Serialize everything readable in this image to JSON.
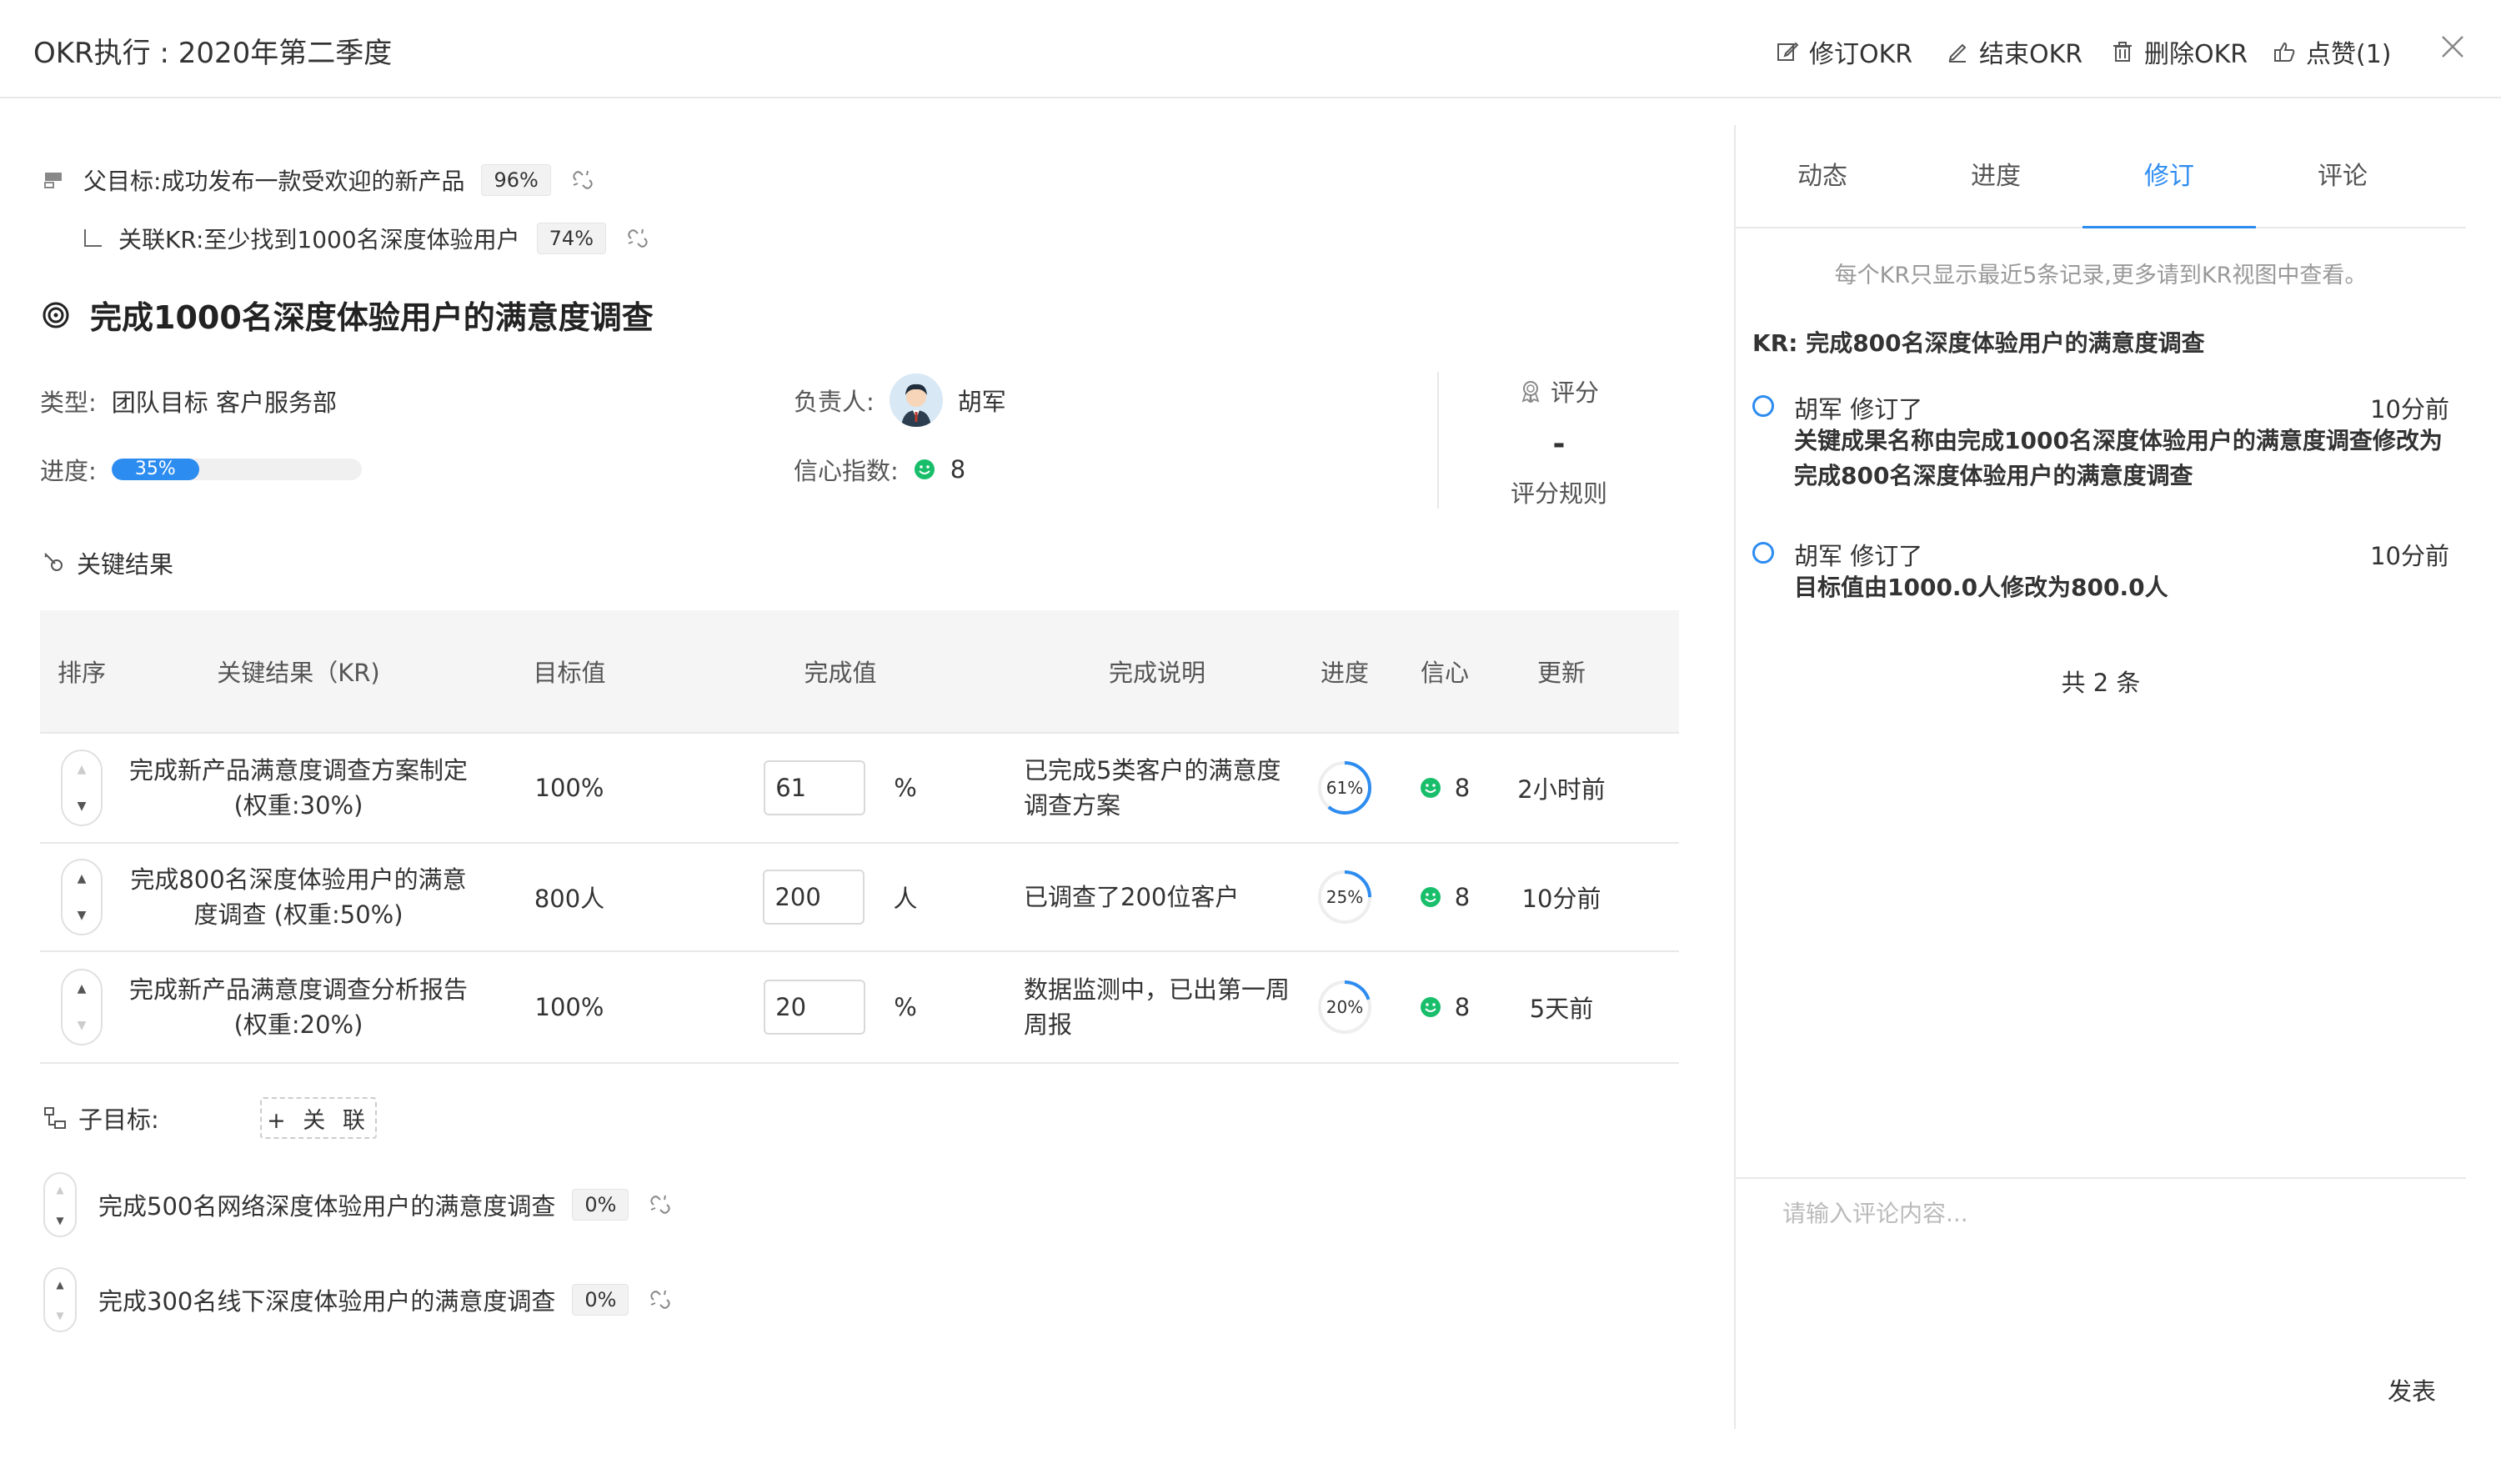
{
  "header": {
    "title": "OKR执行 : 2020年第二季度",
    "revise_okr": "修订OKR",
    "end_okr": "结束OKR",
    "delete_okr": "删除OKR",
    "like": "点赞(1)"
  },
  "parent": {
    "label": "父目标: ",
    "name": "成功发布一款受欢迎的新产品",
    "progress": "96%"
  },
  "linked_kr": {
    "label": "关联KR: ",
    "name": "至少找到1000名深度体验用户",
    "progress": "74%"
  },
  "objective": {
    "title": "完成1000名深度体验用户的满意度调查",
    "type_label": "类型:",
    "type_value": "团队目标 客户服务部",
    "owner_label": "负责人:",
    "owner_name": "胡军",
    "progress_label": "进度:",
    "progress_value": "35%",
    "progress_fraction": 0.35,
    "confidence_label": "信心指数:",
    "confidence_value": "8",
    "score_label": "评分",
    "score_value": "-",
    "score_rules": "评分规则"
  },
  "key_results_section": "关键结果",
  "table": {
    "headers": {
      "sort": "排序",
      "kr": "关键结果（KR)",
      "target": "目标值",
      "done": "完成值",
      "desc": "完成说明",
      "progress": "进度",
      "confidence": "信心",
      "updated": "更新"
    },
    "rows": [
      {
        "kr": "完成新产品满意度调查方案制定 (权重:30%)",
        "target": "100%",
        "done": "61",
        "unit": "%",
        "desc": "已完成5类客户的满意度调查方案",
        "progress": "61%",
        "progress_fraction": 0.61,
        "confidence": "8",
        "updated": "2小时前"
      },
      {
        "kr": "完成800名深度体验用户的满意度调查 (权重:50%)",
        "target": "800人",
        "done": "200",
        "unit": "人",
        "desc": "已调查了200位客户",
        "progress": "25%",
        "progress_fraction": 0.25,
        "confidence": "8",
        "updated": "10分前"
      },
      {
        "kr": "完成新产品满意度调查分析报告 (权重:20%)",
        "target": "100%",
        "done": "20",
        "unit": "%",
        "desc": "数据监测中，已出第一周周报",
        "progress": "20%",
        "progress_fraction": 0.2,
        "confidence": "8",
        "updated": "5天前"
      }
    ]
  },
  "sub_objectives": {
    "label": "子目标:",
    "link_button": "+ 关 联",
    "items": [
      {
        "name": "完成500名网络深度体验用户的满意度调查",
        "progress": "0%"
      },
      {
        "name": "完成300名线下深度体验用户的满意度调查",
        "progress": "0%"
      }
    ]
  },
  "right_panel": {
    "tabs": [
      "动态",
      "进度",
      "修订",
      "评论"
    ],
    "active_tab": 2,
    "hint": "每个KR只显示最近5条记录,更多请到KR视图中查看。",
    "kr_heading": "KR: 完成800名深度体验用户的满意度调查",
    "logs": [
      {
        "who": "胡军 修订了",
        "time": "10分前",
        "body": "关键成果名称由完成1000名深度体验用户的满意度调查修改为完成800名深度体验用户的满意度调查"
      },
      {
        "who": "胡军 修订了",
        "time": "10分前",
        "body": "目标值由1000.0人修改为800.0人"
      }
    ],
    "total": "共 2 条",
    "comment_placeholder": "请输入评论内容...",
    "publish": "发表"
  },
  "colors": {
    "accent": "#2d8cf0",
    "success": "#19be6b"
  }
}
